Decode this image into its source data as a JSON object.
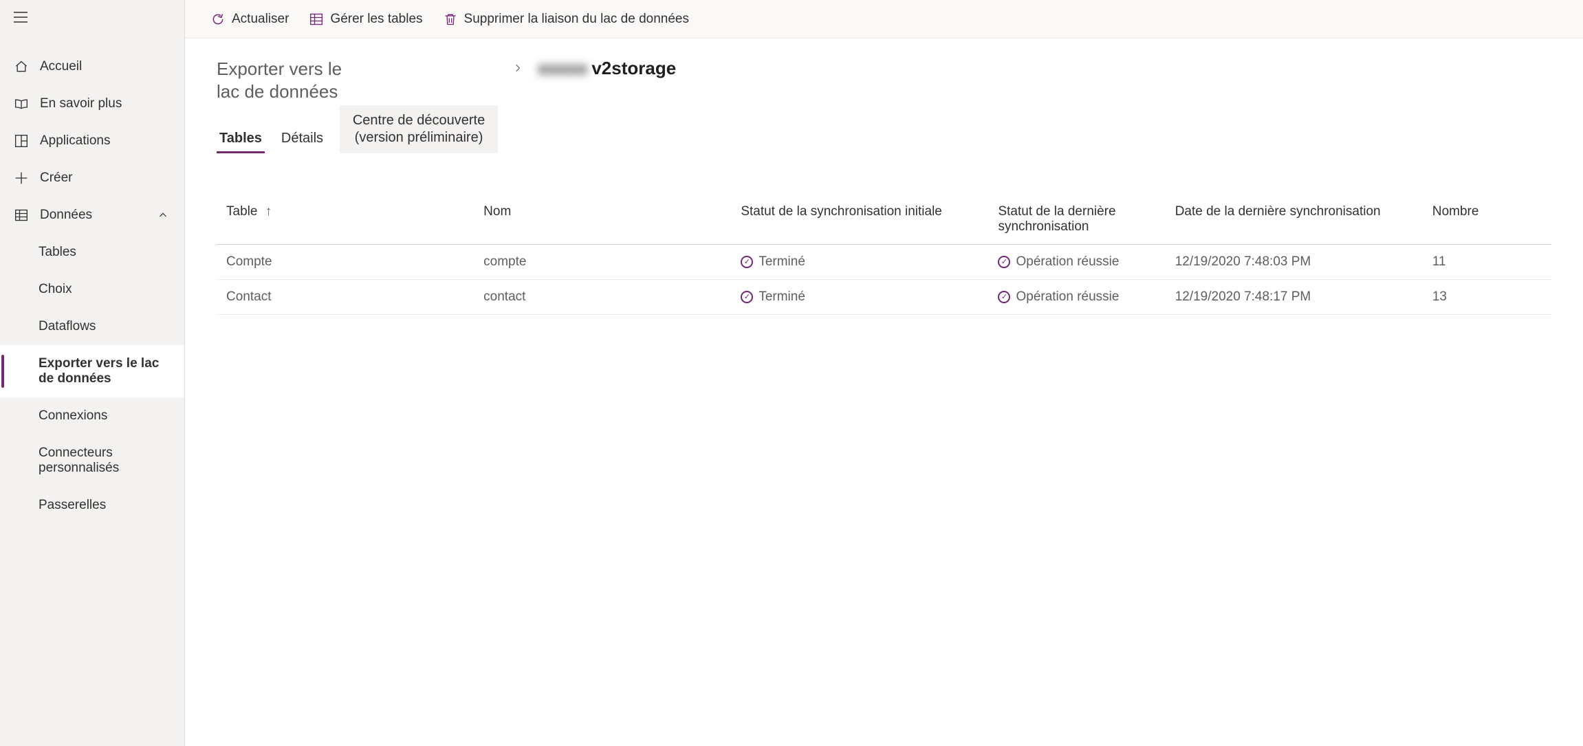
{
  "sidebar": {
    "items": [
      {
        "icon": "home",
        "label": "Accueil"
      },
      {
        "icon": "book",
        "label": "En savoir plus"
      },
      {
        "icon": "apps",
        "label": "Applications"
      },
      {
        "icon": "plus",
        "label": "Créer"
      },
      {
        "icon": "data",
        "label": "Données",
        "expanded": true
      }
    ],
    "dataChildren": [
      {
        "label": "Tables"
      },
      {
        "label": "Choix"
      },
      {
        "label": "Dataflows"
      },
      {
        "label": "Exporter vers le lac de données",
        "active": true
      },
      {
        "label": "Connexions"
      },
      {
        "label": "Connecteurs personnalisés"
      },
      {
        "label": "Passerelles"
      }
    ]
  },
  "toolbar": {
    "refresh": "Actualiser",
    "manage": "Gérer les tables",
    "unlink": "Supprimer la liaison du lac de données"
  },
  "breadcrumb": {
    "root": "Exporter vers le lac de données",
    "current_blur": "xxxxx",
    "current_tail": "v2storage"
  },
  "tabs": [
    {
      "label": "Tables",
      "active": true
    },
    {
      "label": "Détails"
    },
    {
      "label": "Centre de découverte (version préliminaire)",
      "pill": true
    }
  ],
  "table": {
    "columns": [
      "Table",
      "Nom",
      "Statut de la synchronisation initiale",
      "Statut de la dernière synchronisation",
      "Date de la dernière synchronisation",
      "Nombre"
    ],
    "sortColumnIndex": 0,
    "rows": [
      {
        "table": "Compte",
        "name": "compte",
        "initStatus": "Terminé",
        "lastStatus": "Opération réussie",
        "lastDate": "12/19/2020 7:48:03 PM",
        "count": "11"
      },
      {
        "table": "Contact",
        "name": "contact",
        "initStatus": "Terminé",
        "lastStatus": "Opération réussie",
        "lastDate": "12/19/2020 7:48:17 PM",
        "count": "13"
      }
    ]
  }
}
